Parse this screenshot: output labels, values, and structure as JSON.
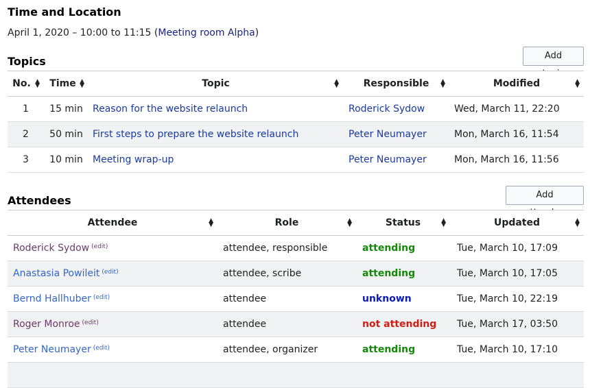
{
  "time_location": {
    "heading": "Time and Location",
    "datetime": "April 1, 2020 – 10:00 to 11:15",
    "room": "Meeting room Alpha"
  },
  "topics": {
    "heading": "Topics",
    "add_button": "Add topic",
    "columns": [
      "No.",
      "Time",
      "Topic",
      "Responsible",
      "Modified"
    ],
    "rows": [
      {
        "no": "1",
        "time": "15 min",
        "topic": "Reason for the website relaunch",
        "responsible": "Roderick Sydow",
        "modified": "Wed, March 11, 22:20"
      },
      {
        "no": "2",
        "time": "50 min",
        "topic": "First steps to prepare the website relaunch",
        "responsible": "Peter Neumayer",
        "modified": "Mon, March 16, 11:54"
      },
      {
        "no": "3",
        "time": "10 min",
        "topic": "Meeting wrap-up",
        "responsible": "Peter Neumayer",
        "modified": "Mon, March 16, 11:56"
      }
    ]
  },
  "attendees": {
    "heading": "Attendees",
    "add_button": "Add attendee",
    "columns": [
      "Attendee",
      "Role",
      "Status",
      "Updated"
    ],
    "edit_label": "(edit)",
    "rows": [
      {
        "name": "Roderick Sydow",
        "role": "attendee, responsible",
        "status": "attending",
        "updated": "Tue, March 10, 17:09"
      },
      {
        "name": "Anastasia Powileit",
        "role": "attendee, scribe",
        "status": "attending",
        "updated": "Tue, March 10, 17:05"
      },
      {
        "name": "Bernd Hallhuber",
        "role": "attendee",
        "status": "unknown",
        "updated": "Tue, March 10, 22:19"
      },
      {
        "name": "Roger Monroe",
        "role": "attendee",
        "status": "not attending",
        "updated": "Tue, March 17, 03:50"
      },
      {
        "name": "Peter Neumayer",
        "role": "attendee, organizer",
        "status": "attending",
        "updated": "Tue, March 10, 17:10"
      }
    ]
  },
  "colors": {
    "attending": "#138a07",
    "unknown": "#0b1bb5",
    "not_attending": "#d11d13",
    "link": "#3366cc",
    "visited_link": "#6b3a6b"
  }
}
